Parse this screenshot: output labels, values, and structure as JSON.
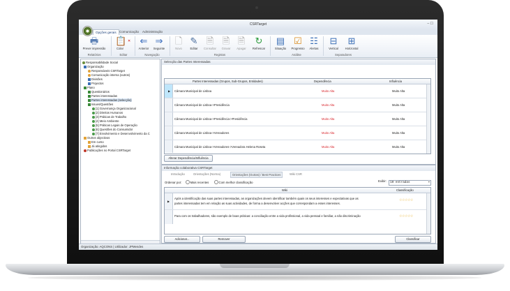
{
  "window": {
    "title": "CSRTarget",
    "controls": "– ☐"
  },
  "ribbon_tabs": [
    "Opções gerais",
    "Comunicação",
    "Administração"
  ],
  "ribbon": {
    "buttons": [
      {
        "label": "Prever impressão",
        "icon": "printer-icon"
      },
      {
        "label": "Colar",
        "icon": "paste-icon"
      },
      {
        "label": "Anterior",
        "icon": "arrow-left-icon"
      },
      {
        "label": "Seguinte",
        "icon": "arrow-right-icon"
      },
      {
        "label": "Novo",
        "icon": "new-document-icon"
      },
      {
        "label": "Editar",
        "icon": "edit-icon"
      },
      {
        "label": "Consultar",
        "icon": "view-document-icon"
      },
      {
        "label": "Gravar",
        "icon": "save-document-icon"
      },
      {
        "label": "Apagar",
        "icon": "delete-document-icon"
      },
      {
        "label": "Refrescar",
        "icon": "refresh-icon"
      },
      {
        "label": "Situação",
        "icon": "situation-icon"
      },
      {
        "label": "Progresso",
        "icon": "progress-icon"
      },
      {
        "label": "Alertas",
        "icon": "alerts-icon"
      },
      {
        "label": "Vertical",
        "icon": "split-vertical-icon"
      },
      {
        "label": "Horizontal",
        "icon": "split-horizontal-icon"
      }
    ],
    "groups": [
      "Relatórios",
      "Editar",
      "Navegação",
      "Registos",
      "Análise",
      "Separadores"
    ]
  },
  "tree": [
    "Responsabilidade Social",
    "Organização",
    "Responsáveis CSRTarget",
    "Comunicação interna (outros)",
    "Divisões",
    "Projectos",
    "Plano",
    "Questionários",
    "Partes interessadas",
    "Partes interessadas (selecção)",
    "Issues/Questões",
    "[1] Governança Organizacional",
    "[2] Direitos Humanos",
    "[3] Práticas de Trabalho",
    "[4] Meio Ambiente",
    "[5] Práticas Legais de Operação",
    "[6] Questões do Consumidor",
    "[7] Envolvimento e Desenvolvimento da C",
    "Outros objectivos",
    "Em curso",
    "Já atingidos",
    "Publicações no Portal CSRTarget"
  ],
  "stakeholders": {
    "section_title": "Selecção das Partes Interessadas",
    "columns": [
      "Partes Interessadas (Grupos, Sub-Grupos, Entidades)",
      "Dependência",
      "Influência"
    ],
    "rows": [
      {
        "name": "Câmara Municipal de Lisboa",
        "dependencia": "Muito Alta",
        "influencia": "Muito Alta"
      },
      {
        "name": "Câmara Municipal de Lisboa->Presidência",
        "dependencia": "Muito Alta",
        "influencia": "Muito Alta"
      },
      {
        "name": "Câmara Municipal de Lisboa->Presidência->Presidência",
        "dependencia": "Muito Alta",
        "influencia": "Muito Alta"
      },
      {
        "name": "Câmara Municipal de Lisboa->Vereadores",
        "dependencia": "Muito Alta",
        "influencia": "Muito Alta"
      },
      {
        "name": "Câmara Municipal de Lisboa->Vereadores->Vereadora Helena Roseta",
        "dependencia": "Muito Alta",
        "influencia": "Muito Alta"
      }
    ],
    "alter_button": "Alterar Dependência/Influência"
  },
  "collab": {
    "section_title": "Informação colaborativa CSRTarget",
    "tabs": [
      "Introdução",
      "Orientações (Norma)",
      "Orientações (Outras) / Best Practices",
      "Wiki CSR"
    ],
    "sort_label": "Ordenar por:",
    "sort_options": [
      "Mais recentes",
      "Com melhor classificação"
    ],
    "show_label": "Exibir:",
    "show_value": "10 entradas",
    "columns": [
      "Wiki",
      "Classificação"
    ],
    "rows": [
      {
        "text_1": "Após a identificação das suas partes interessadas, as organizações devem identificar também quais os seus interesses e expectativas que as",
        "text_2": "partes interessadas tem em relação as suas actividades, de forma a desenvolver acções que correspondam a esses interesses.",
        "stars": "☆☆☆☆☆"
      },
      {
        "text_1": "Para com os trabalhadores, são exemplo de boas práticas: a conciliação entre a vida profissional, a vida pessoal e familiar, a não discriminação",
        "stars": "☆☆☆☆☆"
      }
    ],
    "add_button": "Adicionar...",
    "remove_button": "Remover",
    "classify_button": "Classificar"
  },
  "status_bar": "Organização: AQCONS  |  Utilizador: JPMendes",
  "colors": {
    "high_dependency": "#d9262c",
    "selected_row": "#bfe6fb",
    "accent": "#1a3f7a"
  }
}
